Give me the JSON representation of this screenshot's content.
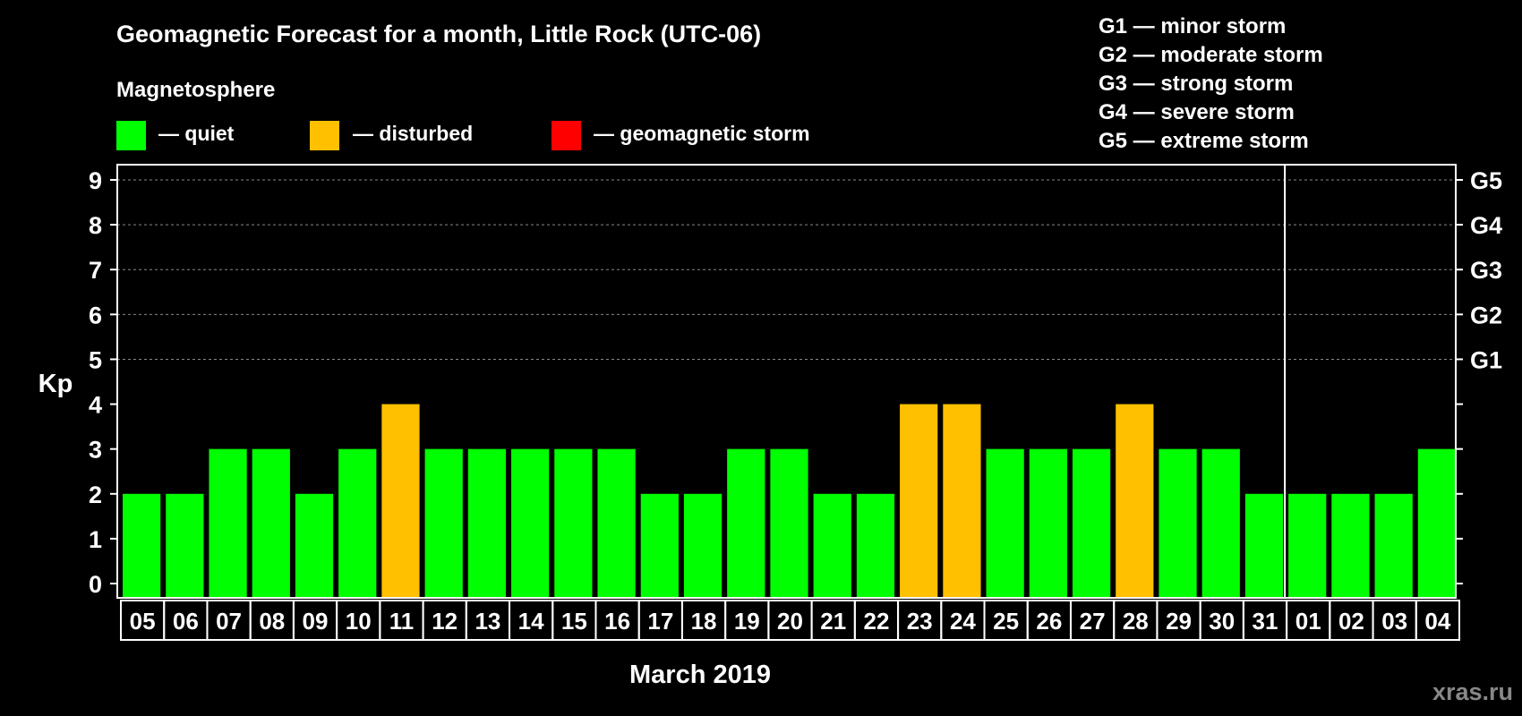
{
  "header": {
    "title": "Geomagnetic Forecast for a month, Little Rock (UTC-06)",
    "section": "Magnetosphere"
  },
  "legend": {
    "items": [
      {
        "label": "— quiet",
        "color": "#00ff00"
      },
      {
        "label": "— disturbed",
        "color": "#ffc000"
      },
      {
        "label": "— geomagnetic storm",
        "color": "#ff0000"
      }
    ]
  },
  "storm_scale": [
    "G1 — minor storm",
    "G2 — moderate storm",
    "G3 — strong storm",
    "G4 — severe storm",
    "G5 — extreme storm"
  ],
  "watermark": "xras.ru",
  "chart_data": {
    "type": "bar",
    "ylabel": "Kp",
    "xlabel": "March 2019",
    "ylim": [
      0,
      9
    ],
    "yticks": [
      "0",
      "1",
      "2",
      "3",
      "4",
      "5",
      "6",
      "7",
      "8",
      "9"
    ],
    "g_levels": [
      {
        "label": "G1",
        "kp": 5
      },
      {
        "label": "G2",
        "kp": 6
      },
      {
        "label": "G3",
        "kp": 7
      },
      {
        "label": "G4",
        "kp": 8
      },
      {
        "label": "G5",
        "kp": 9
      }
    ],
    "categories": [
      "05",
      "06",
      "07",
      "08",
      "09",
      "10",
      "11",
      "12",
      "13",
      "14",
      "15",
      "16",
      "17",
      "18",
      "19",
      "20",
      "21",
      "22",
      "23",
      "24",
      "25",
      "26",
      "27",
      "28",
      "29",
      "30",
      "31",
      "01",
      "02",
      "03",
      "04"
    ],
    "values": [
      2,
      2,
      3,
      3,
      2,
      3,
      4,
      3,
      3,
      3,
      3,
      3,
      2,
      2,
      3,
      3,
      2,
      2,
      4,
      4,
      3,
      3,
      3,
      4,
      3,
      3,
      2,
      2,
      2,
      2,
      3
    ],
    "month_break_after": "31",
    "colors": {
      "quiet": "#00ff00",
      "disturbed": "#ffc000",
      "storm": "#ff0000"
    },
    "grid": true
  }
}
